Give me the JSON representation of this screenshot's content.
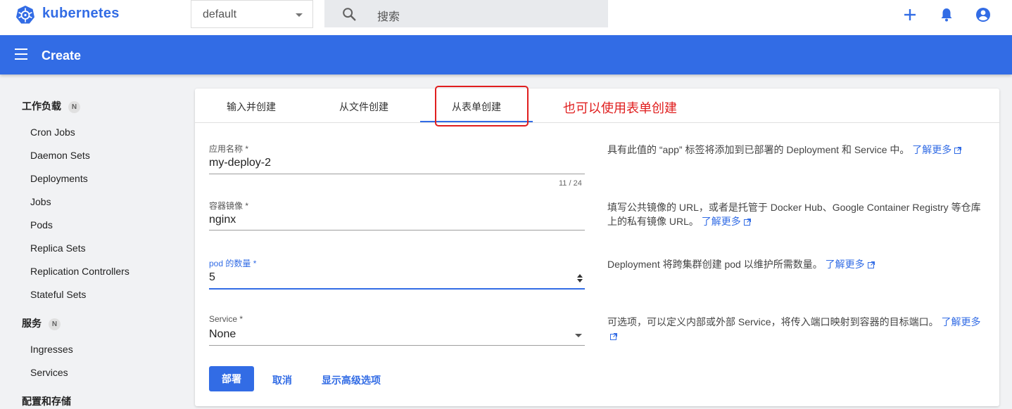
{
  "topbar": {
    "brand": "kubernetes",
    "namespace": "default",
    "search_placeholder": "搜索",
    "icons": [
      "kubernetes-logo-icon",
      "search-icon",
      "add-icon",
      "notifications-bell-icon",
      "account-circle-icon"
    ]
  },
  "header": {
    "title": "Create"
  },
  "sidebar": {
    "sections": [
      {
        "label": "工作负载",
        "badge": "N",
        "items": [
          "Cron Jobs",
          "Daemon Sets",
          "Deployments",
          "Jobs",
          "Pods",
          "Replica Sets",
          "Replication Controllers",
          "Stateful Sets"
        ]
      },
      {
        "label": "服务",
        "badge": "N",
        "items": [
          "Ingresses",
          "Services"
        ]
      },
      {
        "label": "配置和存储"
      }
    ]
  },
  "tabs": [
    "输入并创建",
    "从文件创建",
    "从表单创建"
  ],
  "active_tab": "从表单创建",
  "annotation": "也可以使用表单创建",
  "form": {
    "app_name": {
      "label": "应用名称 *",
      "value": "my-deploy-2",
      "counter": "11 / 24"
    },
    "image": {
      "label": "容器镜像 *",
      "value": "nginx"
    },
    "pods": {
      "label": "pod 的数量 *",
      "value": "5"
    },
    "service": {
      "label": "Service *",
      "value": "None"
    }
  },
  "help": {
    "app_name": "具有此值的 “app” 标签将添加到已部署的 Deployment 和 Service 中。",
    "image": "填写公共镜像的 URL，或者是托管于 Docker Hub、Google Container Registry 等仓库上的私有镜像 URL。",
    "pods": "Deployment 将跨集群创建 pod 以维护所需数量。",
    "service": "可选项，可以定义内部或外部 Service，将传入端口映射到容器的目标端口。",
    "learn_more": "了解更多"
  },
  "actions": {
    "deploy": "部署",
    "cancel": "取消",
    "advanced": "显示高级选项"
  },
  "colors": {
    "primary": "#326ce5",
    "annotation": "#e01e1e"
  }
}
